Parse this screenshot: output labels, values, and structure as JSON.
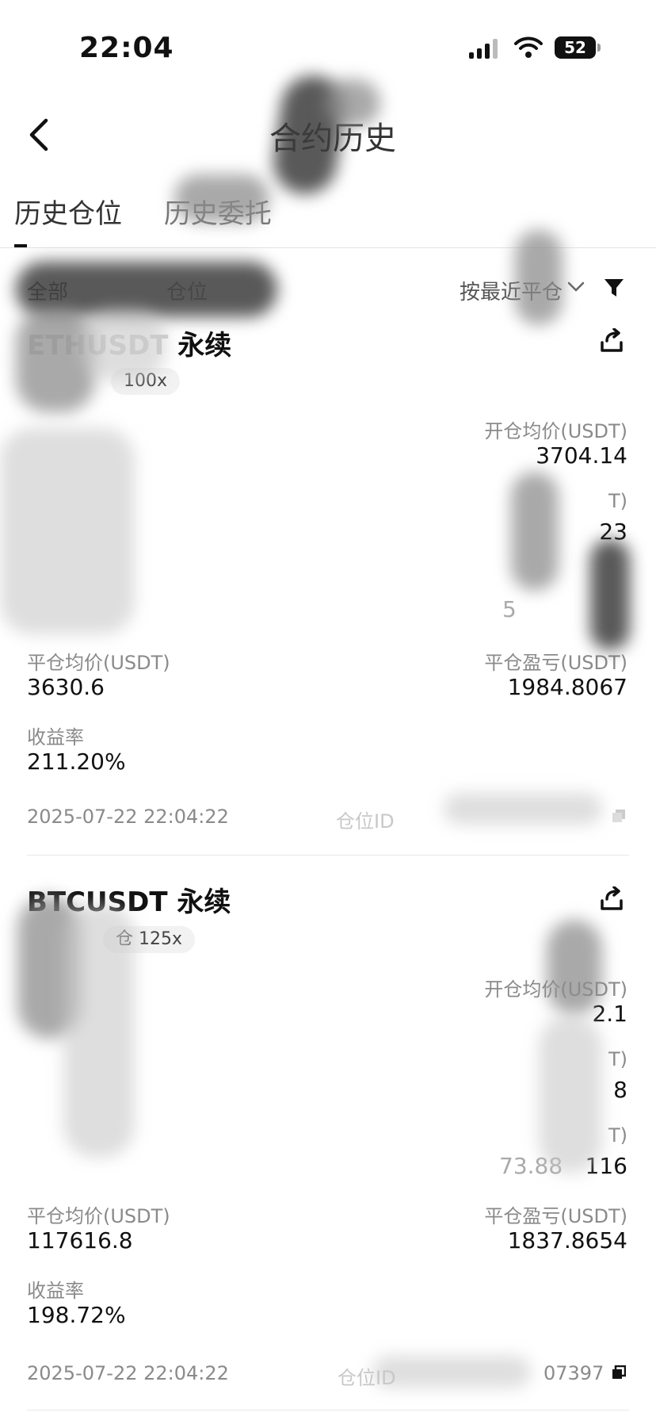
{
  "status_bar": {
    "time": "22:04",
    "battery": "52"
  },
  "nav": {
    "title": "合约历史"
  },
  "tabs": [
    "历史仓位",
    "历史委托"
  ],
  "filter": {
    "all": "全部",
    "position": "仓位",
    "sort": "按最近平仓"
  },
  "cards": [
    {
      "symbol": "永续",
      "leverage": "100x",
      "open_avg_label": "开仓均价(USDT)",
      "open_avg": "3704.14",
      "close_avg_label": "平仓均价(USDT)",
      "close_avg": "3630.6",
      "pnl_label": "平仓盈亏(USDT)",
      "pnl": "1984.8067",
      "roi_label": "收益率",
      "roi": "211.20%",
      "timestamp": "2025-07-22 22:04:22",
      "position_id_label": "仓位ID",
      "partial_values": [
        "T)",
        "23",
        "5"
      ]
    },
    {
      "symbol": "BTCUSDT 永续",
      "leverage": "125x",
      "margin_fragment": "仓",
      "open_avg_label": "开仓均价(USDT)",
      "open_avg": "2.1",
      "close_avg_label": "平仓均价(USDT)",
      "close_avg": "117616.8",
      "pnl_label": "平仓盈亏(USDT)",
      "pnl": "1837.8654",
      "roi_label": "收益率",
      "roi": "198.72%",
      "timestamp": "2025-07-22 22:04:22",
      "position_id_label": "仓位ID",
      "position_id": "07397",
      "partial_values": [
        "T)",
        "8",
        "T)",
        "73.88",
        "116"
      ]
    }
  ]
}
